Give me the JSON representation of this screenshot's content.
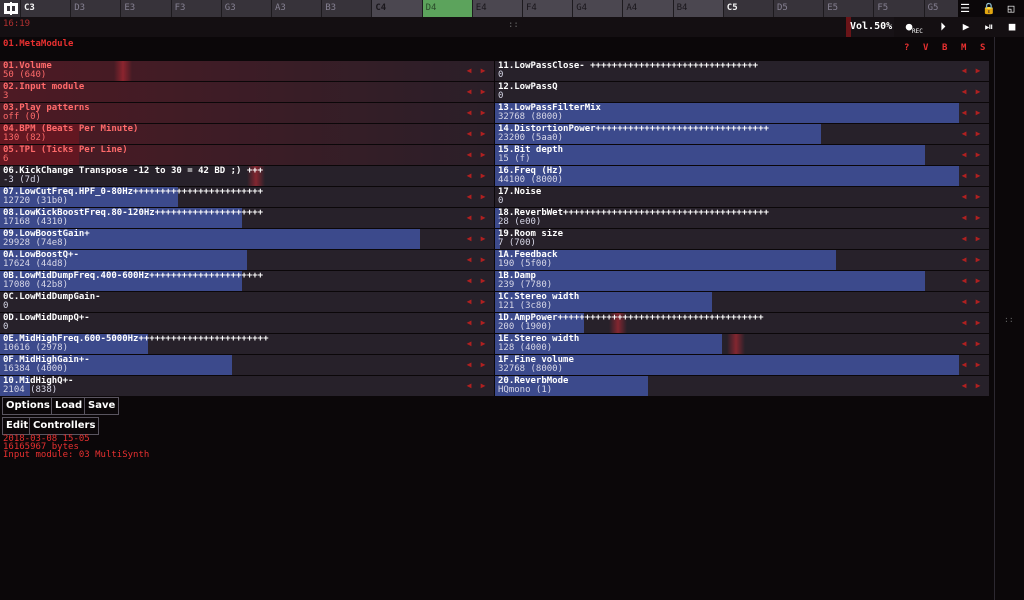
{
  "keyboard": {
    "keys": [
      "C3",
      "D3",
      "E3",
      "F3",
      "G3",
      "A3",
      "B3",
      "C4",
      "D4",
      "E4",
      "F4",
      "G4",
      "A4",
      "B4",
      "C5",
      "D5",
      "E5",
      "F5",
      "G5"
    ],
    "active": "D4",
    "highlight": [
      "C4",
      "E4",
      "F4",
      "G4",
      "A4",
      "B4"
    ]
  },
  "topbar": {
    "time": "16:19",
    "volume": "Vol.50%",
    "volume_fraction": 0.5,
    "rec_label": "REC",
    "grip": "::"
  },
  "module": {
    "title": "01.MetaModule",
    "header_buttons": [
      "?",
      "V",
      "B",
      "M",
      "S"
    ]
  },
  "controllers": [
    {
      "name": "01.Volume",
      "value": "50 (640)",
      "fraction": 0.0,
      "col": 0,
      "style": "red",
      "marker": 0.23
    },
    {
      "name": "02.Input module",
      "value": "3",
      "fraction": 0.0,
      "col": 0,
      "style": "red"
    },
    {
      "name": "03.Play patterns",
      "value": "off (0)",
      "fraction": 0.0,
      "col": 0,
      "style": "red"
    },
    {
      "name": "04.BPM (Beats Per Minute)",
      "value": "130 (82)",
      "fraction": 0.16,
      "col": 0,
      "style": "red"
    },
    {
      "name": "05.TPL (Ticks Per Line)",
      "value": "6",
      "fraction": 0.16,
      "col": 0,
      "style": "red"
    },
    {
      "name": "06.KickChange Transpose -12 to 30 = 42 BD ;) +++",
      "value": "-3 (7d)",
      "fraction": 0.0,
      "col": 0,
      "style": "blue",
      "marker": 0.5
    },
    {
      "name": "07.LowCutFreq.HPF_0-80Hz++++++++++++++++++++++++",
      "value": "12720 (31b0)",
      "fraction": 0.36,
      "col": 0,
      "style": "blue"
    },
    {
      "name": "08.LowKickBoostFreq.80-120Hz++++++++++++++++++++",
      "value": "17168 (4310)",
      "fraction": 0.49,
      "col": 0,
      "style": "blue"
    },
    {
      "name": "09.LowBoostGain+",
      "value": "29928 (74e8)",
      "fraction": 0.85,
      "col": 0,
      "style": "blue"
    },
    {
      "name": "0A.LowBoostQ+-",
      "value": "17624 (44d8)",
      "fraction": 0.5,
      "col": 0,
      "style": "blue"
    },
    {
      "name": "0B.LowMidDumpFreq.400-600Hz+++++++++++++++++++++",
      "value": "17080 (42b8)",
      "fraction": 0.49,
      "col": 0,
      "style": "blue"
    },
    {
      "name": "0C.LowMidDumpGain-",
      "value": "0",
      "fraction": 0.0,
      "col": 0,
      "style": "blue"
    },
    {
      "name": "0D.LowMidDumpQ+-",
      "value": "0",
      "fraction": 0.0,
      "col": 0,
      "style": "blue"
    },
    {
      "name": "0E.MidHighFreq.600-5000Hz++++++++++++++++++++++++",
      "value": "10616 (2978)",
      "fraction": 0.3,
      "col": 0,
      "style": "blue"
    },
    {
      "name": "0F.MidHighGain+-",
      "value": "16384 (4000)",
      "fraction": 0.47,
      "col": 0,
      "style": "blue"
    },
    {
      "name": "10.MidHighQ+-",
      "value": "2104 (838)",
      "fraction": 0.06,
      "col": 0,
      "style": "blue"
    },
    {
      "name": "11.LowPassClose- +++++++++++++++++++++++++++++++",
      "value": "0",
      "fraction": 0.0,
      "col": 1,
      "style": "blue"
    },
    {
      "name": "12.LowPassQ",
      "value": "0",
      "fraction": 0.0,
      "col": 1,
      "style": "blue"
    },
    {
      "name": "13.LowPassFilterMix",
      "value": "32768 (8000)",
      "fraction": 0.94,
      "col": 1,
      "style": "blue"
    },
    {
      "name": "14.DistortionPower++++++++++++++++++++++++++++++++",
      "value": "23200 (5aa0)",
      "fraction": 0.66,
      "col": 1,
      "style": "blue"
    },
    {
      "name": "15.Bit depth",
      "value": "15 (f)",
      "fraction": 0.87,
      "col": 1,
      "style": "blue"
    },
    {
      "name": "16.Freq (Hz)",
      "value": "44100 (8000)",
      "fraction": 0.94,
      "col": 1,
      "style": "blue"
    },
    {
      "name": "17.Noise",
      "value": "0",
      "fraction": 0.0,
      "col": 1,
      "style": "blue"
    },
    {
      "name": "18.ReverbWet++++++++++++++++++++++++++++++++++++++",
      "value": "28 (e00)",
      "fraction": 0.01,
      "col": 1,
      "style": "blue"
    },
    {
      "name": "19.Room size",
      "value": "7 (700)",
      "fraction": 0.01,
      "col": 1,
      "style": "blue"
    },
    {
      "name": "1A.Feedback",
      "value": "190 (5f00)",
      "fraction": 0.69,
      "col": 1,
      "style": "blue"
    },
    {
      "name": "1B.Damp",
      "value": "239 (7780)",
      "fraction": 0.87,
      "col": 1,
      "style": "blue"
    },
    {
      "name": "1C.Stereo width",
      "value": "121 (3c80)",
      "fraction": 0.44,
      "col": 1,
      "style": "blue"
    },
    {
      "name": "1D.AmpPower++++++++++++++++++++++++++++++++++++++",
      "value": "200 (1900)",
      "fraction": 0.18,
      "col": 1,
      "style": "blue",
      "marker": 0.23
    },
    {
      "name": "1E.Stereo width",
      "value": "128 (4000)",
      "fraction": 0.46,
      "col": 1,
      "style": "blue",
      "marker": 0.47
    },
    {
      "name": "1F.Fine volume",
      "value": "32768 (8000)",
      "fraction": 0.94,
      "col": 1,
      "style": "blue"
    },
    {
      "name": "20.ReverbMode",
      "value": "HQmono (1)",
      "fraction": 0.31,
      "col": 1,
      "style": "blue"
    }
  ],
  "buttons": {
    "options": "Options",
    "load": "Load",
    "save": "Save",
    "edit": "Edit",
    "controllers": "Controllers"
  },
  "info": {
    "date": "2018-03-08 15-05",
    "size": "16165967 bytes",
    "input": "Input module: 03 MultiSynth"
  },
  "colors": {
    "red_fill": "#5a1a24",
    "blue_fill": "#3c4a8c",
    "bg_row": "#27212a",
    "accent_red": "#e83030",
    "active_key": "#5ca35c"
  }
}
